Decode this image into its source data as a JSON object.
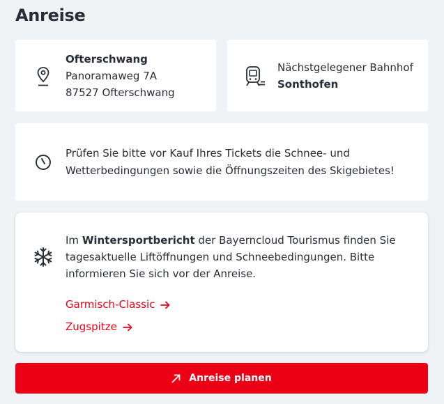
{
  "page": {
    "title": "Anreise"
  },
  "address": {
    "icon": "map-pin-icon",
    "name": "Ofterschwang",
    "street": "Panoramaweg 7A",
    "city": "87527 Ofterschwang"
  },
  "station": {
    "icon": "train-icon",
    "label": "Nächstgelegener Bahnhof",
    "name": "Sonthofen"
  },
  "hint": {
    "icon": "clock-icon",
    "line1": "Prüfen Sie bitte vor Kauf Ihres Tickets die Schnee- und",
    "line2": "Wetterbedingungen sowie die Öffnungszeiten des Skigebietes!"
  },
  "winter": {
    "icon": "snowflake-icon",
    "intro_prefix": "Im ",
    "intro_bold": "Wintersportbericht",
    "intro_rest": " der Bayerncloud Tourismus finden Sie",
    "line2": "tagesaktuelle Liftöffnungen und Schneebedingungen. Bitte",
    "line3": "informieren Sie sich vor der Anreise.",
    "links": [
      {
        "label": "Garmisch-Classic",
        "icon": "arrow-right-icon"
      },
      {
        "label": "Zugspitze",
        "icon": "arrow-right-icon"
      }
    ]
  },
  "cta": {
    "label": "Anreise planen",
    "icon": "arrow-up-right-icon"
  },
  "colors": {
    "accent": "#ec0016",
    "background": "#f0f3f5",
    "text": "#282d37"
  }
}
